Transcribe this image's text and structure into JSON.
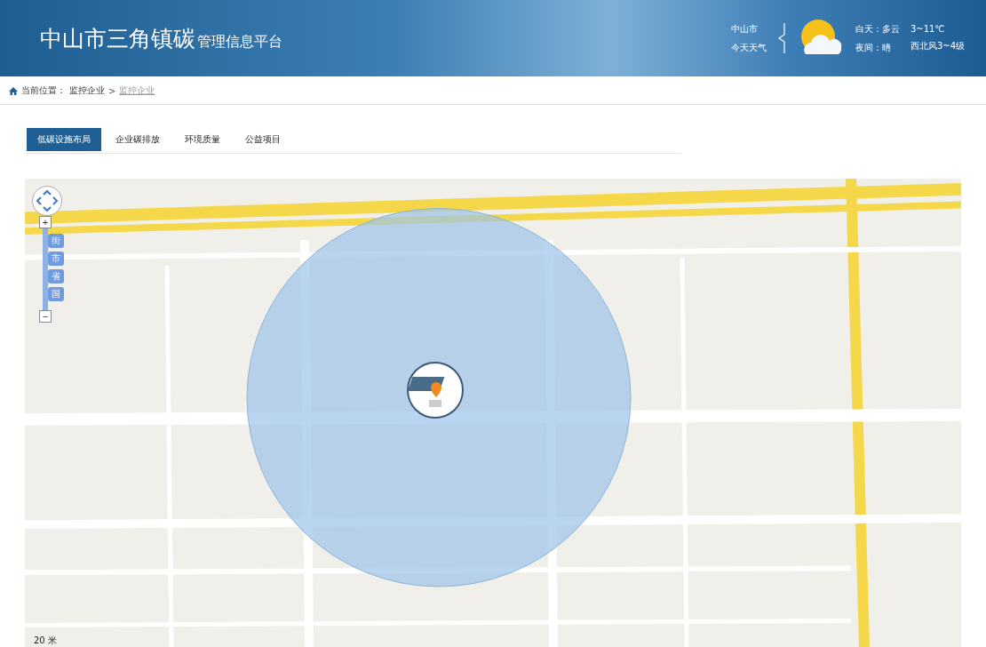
{
  "header": {
    "title_main": "中山市三角镇碳",
    "title_sub": "管理信息平台",
    "weather": {
      "city": "中山市",
      "label": "今天天气",
      "day": "白天：多云",
      "night": "夜间：晴",
      "temperature": "3~11℃",
      "wind": "西北风3~4级"
    }
  },
  "breadcrumb": {
    "label": "当前位置：",
    "items": [
      {
        "text": "监控企业",
        "selected": false
      },
      {
        "text": "监控企业",
        "selected": true
      }
    ],
    "separator": ">"
  },
  "tabs": [
    {
      "label": "低碳设施布局",
      "selected": true
    },
    {
      "label": "企业碳排放",
      "selected": false
    },
    {
      "label": "环境质量",
      "selected": false
    },
    {
      "label": "公益项目",
      "selected": false
    }
  ],
  "map": {
    "zoom_levels": [
      {
        "label": "街"
      },
      {
        "label": "市"
      },
      {
        "label": "省"
      },
      {
        "label": "国"
      }
    ],
    "zoom_in": "+",
    "zoom_out": "−",
    "scale": "20 米"
  }
}
